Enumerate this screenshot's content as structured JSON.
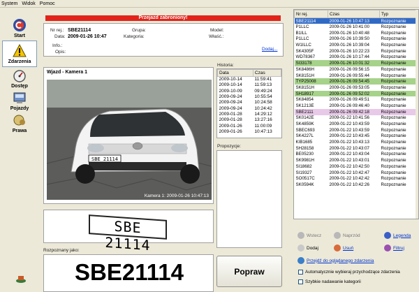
{
  "menu": [
    "System",
    "Widok",
    "Pomoc"
  ],
  "sidebar": [
    {
      "label": "Start",
      "icon": "start-icon"
    },
    {
      "label": "Zdarzenia",
      "icon": "warning-icon"
    },
    {
      "label": "Dostęp",
      "icon": "gauge-icon"
    },
    {
      "label": "Pojazdy",
      "icon": "vehicles-icon"
    },
    {
      "label": "Prawa",
      "icon": "rights-icon"
    }
  ],
  "banner": "Przejazd zabroniony!",
  "info": {
    "nr_label": "Nr rej.:",
    "nr_value": "SBE21114",
    "data_label": "Data:",
    "data_value": "2009-01-26 10:47",
    "info_label": "Info.:",
    "opis_label": "Opis:",
    "grupa_label": "Grupa:",
    "kategoria_label": "Kategoria:",
    "model_label": "Model:",
    "wlasc_label": "Właść.:",
    "dodaj_link": "Dodaj..."
  },
  "camera": {
    "title": "Wjazd - Kamera 1",
    "plate_on_car": "SBE 21114",
    "timestamp": "Kamera 1: 2009-01-26 10:47:13"
  },
  "plate_crop": "SBE 21114",
  "recognized": {
    "label": "Rozpoznany jako:",
    "value": "SBE21114"
  },
  "history": {
    "label": "Historia:",
    "columns": [
      "Data",
      "Czas"
    ],
    "rows": [
      [
        "2009-10-14",
        "11:59:41"
      ],
      [
        "2009-10-14",
        "11:59:13"
      ],
      [
        "2009-10-09",
        "09:49:24"
      ],
      [
        "2009-09-24",
        "10:55:54"
      ],
      [
        "2009-09-24",
        "10:24:58"
      ],
      [
        "2009-09-24",
        "10:24:42"
      ],
      [
        "2009-01-28",
        "14:29:12"
      ],
      [
        "2009-01-28",
        "13:27:16"
      ],
      [
        "2009-01-26",
        "11:00:09"
      ],
      [
        "2009-01-26",
        "10:47:13"
      ]
    ]
  },
  "proposals": {
    "label": "Propozycje:"
  },
  "popraw": "Popraw",
  "events": {
    "columns": [
      "Nr rej.",
      "Czas",
      "Typ"
    ],
    "rows": [
      {
        "nr": "SBE21114",
        "czas": "2009-01-26 10:47:13",
        "typ": "Rozpoznanie",
        "style": "sel"
      },
      {
        "nr": "P1LLC",
        "czas": "2009-01-26 10:41:00",
        "typ": "Rozpoznanie",
        "style": ""
      },
      {
        "nr": "B1ILL",
        "czas": "2009-01-26 10:40:48",
        "typ": "Rozpoznanie",
        "style": ""
      },
      {
        "nr": "P1LLC",
        "czas": "2009-01-26 10:39:50",
        "typ": "Rozpoznanie",
        "style": ""
      },
      {
        "nr": "W1ILLC",
        "czas": "2009-01-26 10:39:04",
        "typ": "Rozpoznanie",
        "style": ""
      },
      {
        "nr": "SK4305F",
        "czas": "2009-01-26 10:22:23",
        "typ": "Rozpoznanie",
        "style": ""
      },
      {
        "nr": "WD78367",
        "czas": "2009-01-26 10:17:44",
        "typ": "Rozpoznanie",
        "style": ""
      },
      {
        "nr": "SI33178",
        "czas": "2009-01-26 10:01:32",
        "typ": "Rozpoznanie",
        "style": "green"
      },
      {
        "nr": "SK8486H",
        "czas": "2009-01-26 09:56:15",
        "typ": "Rozpoznanie",
        "style": ""
      },
      {
        "nr": "SK8151H",
        "czas": "2009-01-26 09:55:44",
        "typ": "Rozpoznanie",
        "style": ""
      },
      {
        "nr": "TYP25008",
        "czas": "2009-01-26 09:54:45",
        "typ": "Rozpoznanie",
        "style": "green"
      },
      {
        "nr": "SK8151H",
        "czas": "2009-01-26 09:53:05",
        "typ": "Rozpoznanie",
        "style": ""
      },
      {
        "nr": "SH18917",
        "czas": "2009-01-26 09:52:02",
        "typ": "Rozpoznanie",
        "style": "green"
      },
      {
        "nr": "SK84854",
        "czas": "2009-01-26 09:49:51",
        "typ": "Rozpoznanie",
        "style": ""
      },
      {
        "nr": "SK1213E",
        "czas": "2009-01-26 09:46:40",
        "typ": "Rozpoznanie",
        "style": ""
      },
      {
        "nr": "SBE2111",
        "czas": "2009-01-26 09:42:18",
        "typ": "Rozpoznanie",
        "style": "pink"
      },
      {
        "nr": "SK0142E",
        "czas": "2009-01-22 10:41:56",
        "typ": "Rozpoznanie",
        "style": ""
      },
      {
        "nr": "SK4859K",
        "czas": "2009-01-22 10:43:59",
        "typ": "Rozpoznanie",
        "style": ""
      },
      {
        "nr": "SBEC693",
        "czas": "2009-01-22 10:43:59",
        "typ": "Rozpoznanie",
        "style": ""
      },
      {
        "nr": "SK4227L",
        "czas": "2009-01-22 10:43:45",
        "typ": "Rozpoznanie",
        "style": ""
      },
      {
        "nr": "KIB1685",
        "czas": "2009-01-22 10:43:13",
        "typ": "Rozpoznanie",
        "style": ""
      },
      {
        "nr": "SH28158",
        "czas": "2009-01-22 10:43:07",
        "typ": "Rozpoznanie",
        "style": ""
      },
      {
        "nr": "BE05230",
        "czas": "2009-01-22 10:43:04",
        "typ": "Rozpoznanie",
        "style": ""
      },
      {
        "nr": "SK9981H",
        "czas": "2009-01-22 10:43:01",
        "typ": "Rozpoznanie",
        "style": ""
      },
      {
        "nr": "SI18682",
        "czas": "2009-01-22 10:42:50",
        "typ": "Rozpoznanie",
        "style": ""
      },
      {
        "nr": "SI19327",
        "czas": "2009-01-22 10:42:47",
        "typ": "Rozpoznanie",
        "style": ""
      },
      {
        "nr": "SO0517C",
        "czas": "2009-01-22 10:42:42",
        "typ": "Rozpoznanie",
        "style": ""
      },
      {
        "nr": "SK0594K",
        "czas": "2009-01-22 10:42:26",
        "typ": "Rozpoznanie",
        "style": ""
      }
    ]
  },
  "controls": {
    "wstecz": "Wstecz",
    "naprzod": "Naprzód",
    "legenda": "Legenda",
    "dodaj": "Dodaj",
    "usun": "Usuń",
    "filtruj": "Filtruj",
    "przejdz": "Przejdź do oglądanego zdarzenia",
    "auto": "Automatycznie wybieraj przychodzące zdarzenia",
    "szybkie": "Szybkie nadawanie kategorii"
  }
}
